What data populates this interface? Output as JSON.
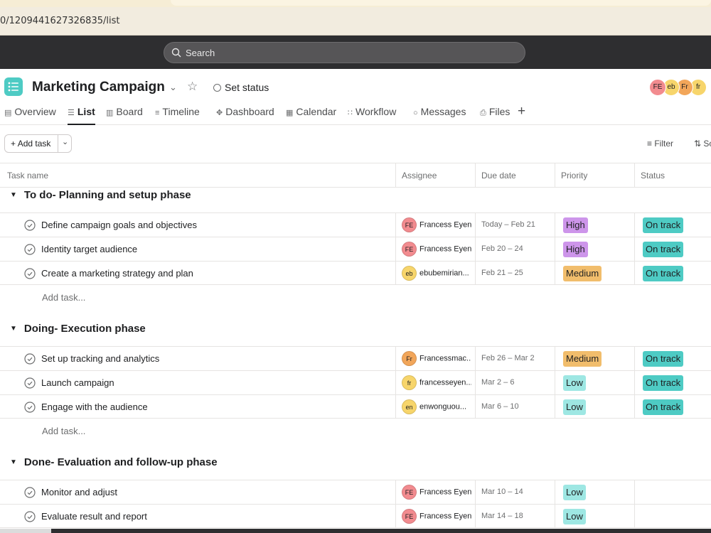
{
  "browser": {
    "url": "0/1209441627326835/list"
  },
  "search": {
    "placeholder": "Search"
  },
  "project": {
    "title": "Marketing Campaign",
    "set_status": "Set status",
    "members": [
      {
        "initials": "FE",
        "color": "#f28b8f"
      },
      {
        "initials": "eb",
        "color": "#f7d56b"
      },
      {
        "initials": "Fr",
        "color": "#f2a65a"
      },
      {
        "initials": "fr",
        "color": "#f7d56b"
      }
    ]
  },
  "tabs": [
    {
      "label": "Overview",
      "icon": "overview-icon"
    },
    {
      "label": "List",
      "icon": "list-icon",
      "active": true
    },
    {
      "label": "Board",
      "icon": "board-icon"
    },
    {
      "label": "Timeline",
      "icon": "timeline-icon"
    },
    {
      "label": "Dashboard",
      "icon": "dashboard-icon"
    },
    {
      "label": "Calendar",
      "icon": "calendar-icon"
    },
    {
      "label": "Workflow",
      "icon": "workflow-icon"
    },
    {
      "label": "Messages",
      "icon": "messages-icon"
    },
    {
      "label": "Files",
      "icon": "files-icon"
    }
  ],
  "toolbar": {
    "add_task": "Add task",
    "filter": "Filter",
    "sort": "So"
  },
  "columns": [
    "Task name",
    "Assignee",
    "Due date",
    "Priority",
    "Status"
  ],
  "priority_colors": {
    "High": "#cd95ea",
    "Medium": "#f1bd6c",
    "Low": "#9ee7e3"
  },
  "status_color": "#4ecbc4",
  "add_task_row": "Add task...",
  "sections": [
    {
      "title": "To do- Planning and setup phase",
      "tasks": [
        {
          "name": "Define campaign goals and objectives",
          "assignee": "Francess Eyen",
          "initials": "FE",
          "avatar_color": "#f28b8f",
          "due": "Today – Feb 21",
          "priority": "High",
          "status": "On track"
        },
        {
          "name": "Identity target audience",
          "assignee": "Francess Eyen",
          "initials": "FE",
          "avatar_color": "#f28b8f",
          "due": "Feb 20 – 24",
          "priority": "High",
          "status": "On track"
        },
        {
          "name": "Create a marketing strategy and plan",
          "assignee": "ebubemirian...",
          "initials": "eb",
          "avatar_color": "#f7d56b",
          "due": "Feb 21 – 25",
          "priority": "Medium",
          "status": "On track"
        }
      ]
    },
    {
      "title": "Doing- Execution phase",
      "tasks": [
        {
          "name": "Set up tracking and analytics",
          "assignee": "Francessmac...",
          "initials": "Fr",
          "avatar_color": "#f2a65a",
          "due": "Feb 26 – Mar 2",
          "priority": "Medium",
          "status": "On track"
        },
        {
          "name": "Launch campaign",
          "assignee": "francesseyen...",
          "initials": "fr",
          "avatar_color": "#f7d56b",
          "due": "Mar 2 – 6",
          "priority": "Low",
          "status": "On track"
        },
        {
          "name": "Engage with the audience",
          "assignee": "enwonguou...",
          "initials": "en",
          "avatar_color": "#f7d56b",
          "due": "Mar 6 – 10",
          "priority": "Low",
          "status": "On track"
        }
      ]
    },
    {
      "title": "Done- Evaluation and follow-up phase",
      "tasks": [
        {
          "name": "Monitor and adjust",
          "assignee": "Francess Eyen",
          "initials": "FE",
          "avatar_color": "#f28b8f",
          "due": "Mar 10 – 14",
          "priority": "Low",
          "status": ""
        },
        {
          "name": "Evaluate result and report",
          "assignee": "Francess Eyen",
          "initials": "FE",
          "avatar_color": "#f28b8f",
          "due": "Mar 14 – 18",
          "priority": "Low",
          "status": ""
        }
      ]
    }
  ]
}
